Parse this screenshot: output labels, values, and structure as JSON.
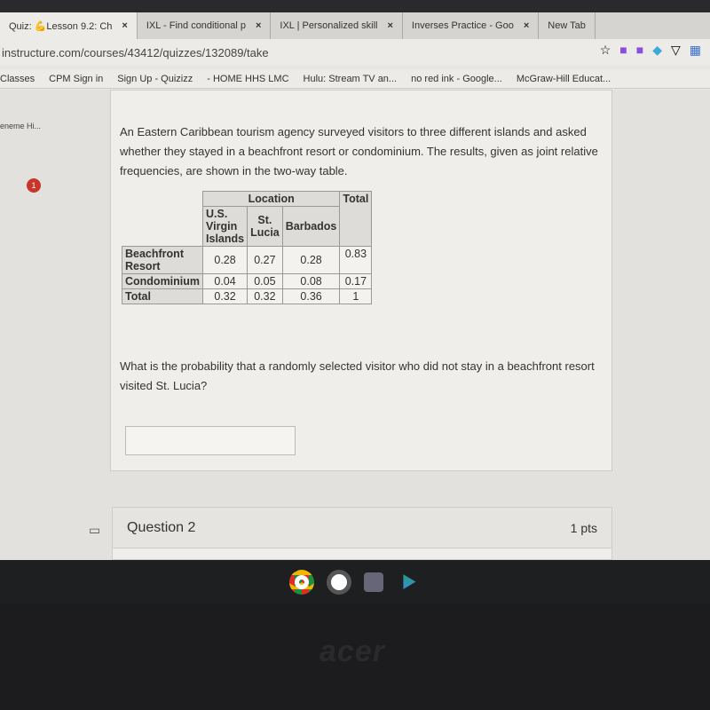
{
  "browser": {
    "tabs": [
      {
        "label": "Quiz: 💪Lesson 9.2: Ch",
        "active": true
      },
      {
        "label": "IXL - Find conditional p",
        "active": false
      },
      {
        "label": "IXL | Personalized skill",
        "active": false
      },
      {
        "label": "Inverses Practice - Goo",
        "active": false
      },
      {
        "label": "New Tab",
        "active": false
      }
    ],
    "close_label": "×",
    "url": "instructure.com/courses/43412/quizzes/132089/take",
    "bookmarks": [
      "Classes",
      "CPM Sign in",
      "Sign Up - Quizizz",
      "- HOME HHS LMC",
      "Hulu: Stream TV an...",
      "no red ink - Google...",
      "McGraw-Hill Educat..."
    ]
  },
  "sidebar": {
    "item": "eneme Hi...",
    "badge": "1"
  },
  "question1": {
    "text": "An Eastern Caribbean tourism agency surveyed visitors to three different islands and asked whether they stayed in a beachfront resort or condominium. The results, given as joint relative frequencies, are shown in the two-way table.",
    "table": {
      "group_header": "Location",
      "columns": [
        "U.S. Virgin Islands",
        "St. Lucia",
        "Barbados",
        "Total"
      ],
      "rows": [
        {
          "label": "Beachfront Resort",
          "values": [
            "0.28",
            "0.27",
            "0.28",
            "0.83"
          ]
        },
        {
          "label": "Condominium",
          "values": [
            "0.04",
            "0.05",
            "0.08",
            "0.17"
          ]
        },
        {
          "label": "Total",
          "values": [
            "0.32",
            "0.32",
            "0.36",
            "1"
          ]
        }
      ]
    },
    "prompt": "What is the probability that a randomly selected visitor who did not stay in a beachfront resort visited St. Lucia?",
    "answer_value": ""
  },
  "question2": {
    "title": "Question 2",
    "points": "1 pts"
  },
  "device": {
    "brand": "acer"
  }
}
